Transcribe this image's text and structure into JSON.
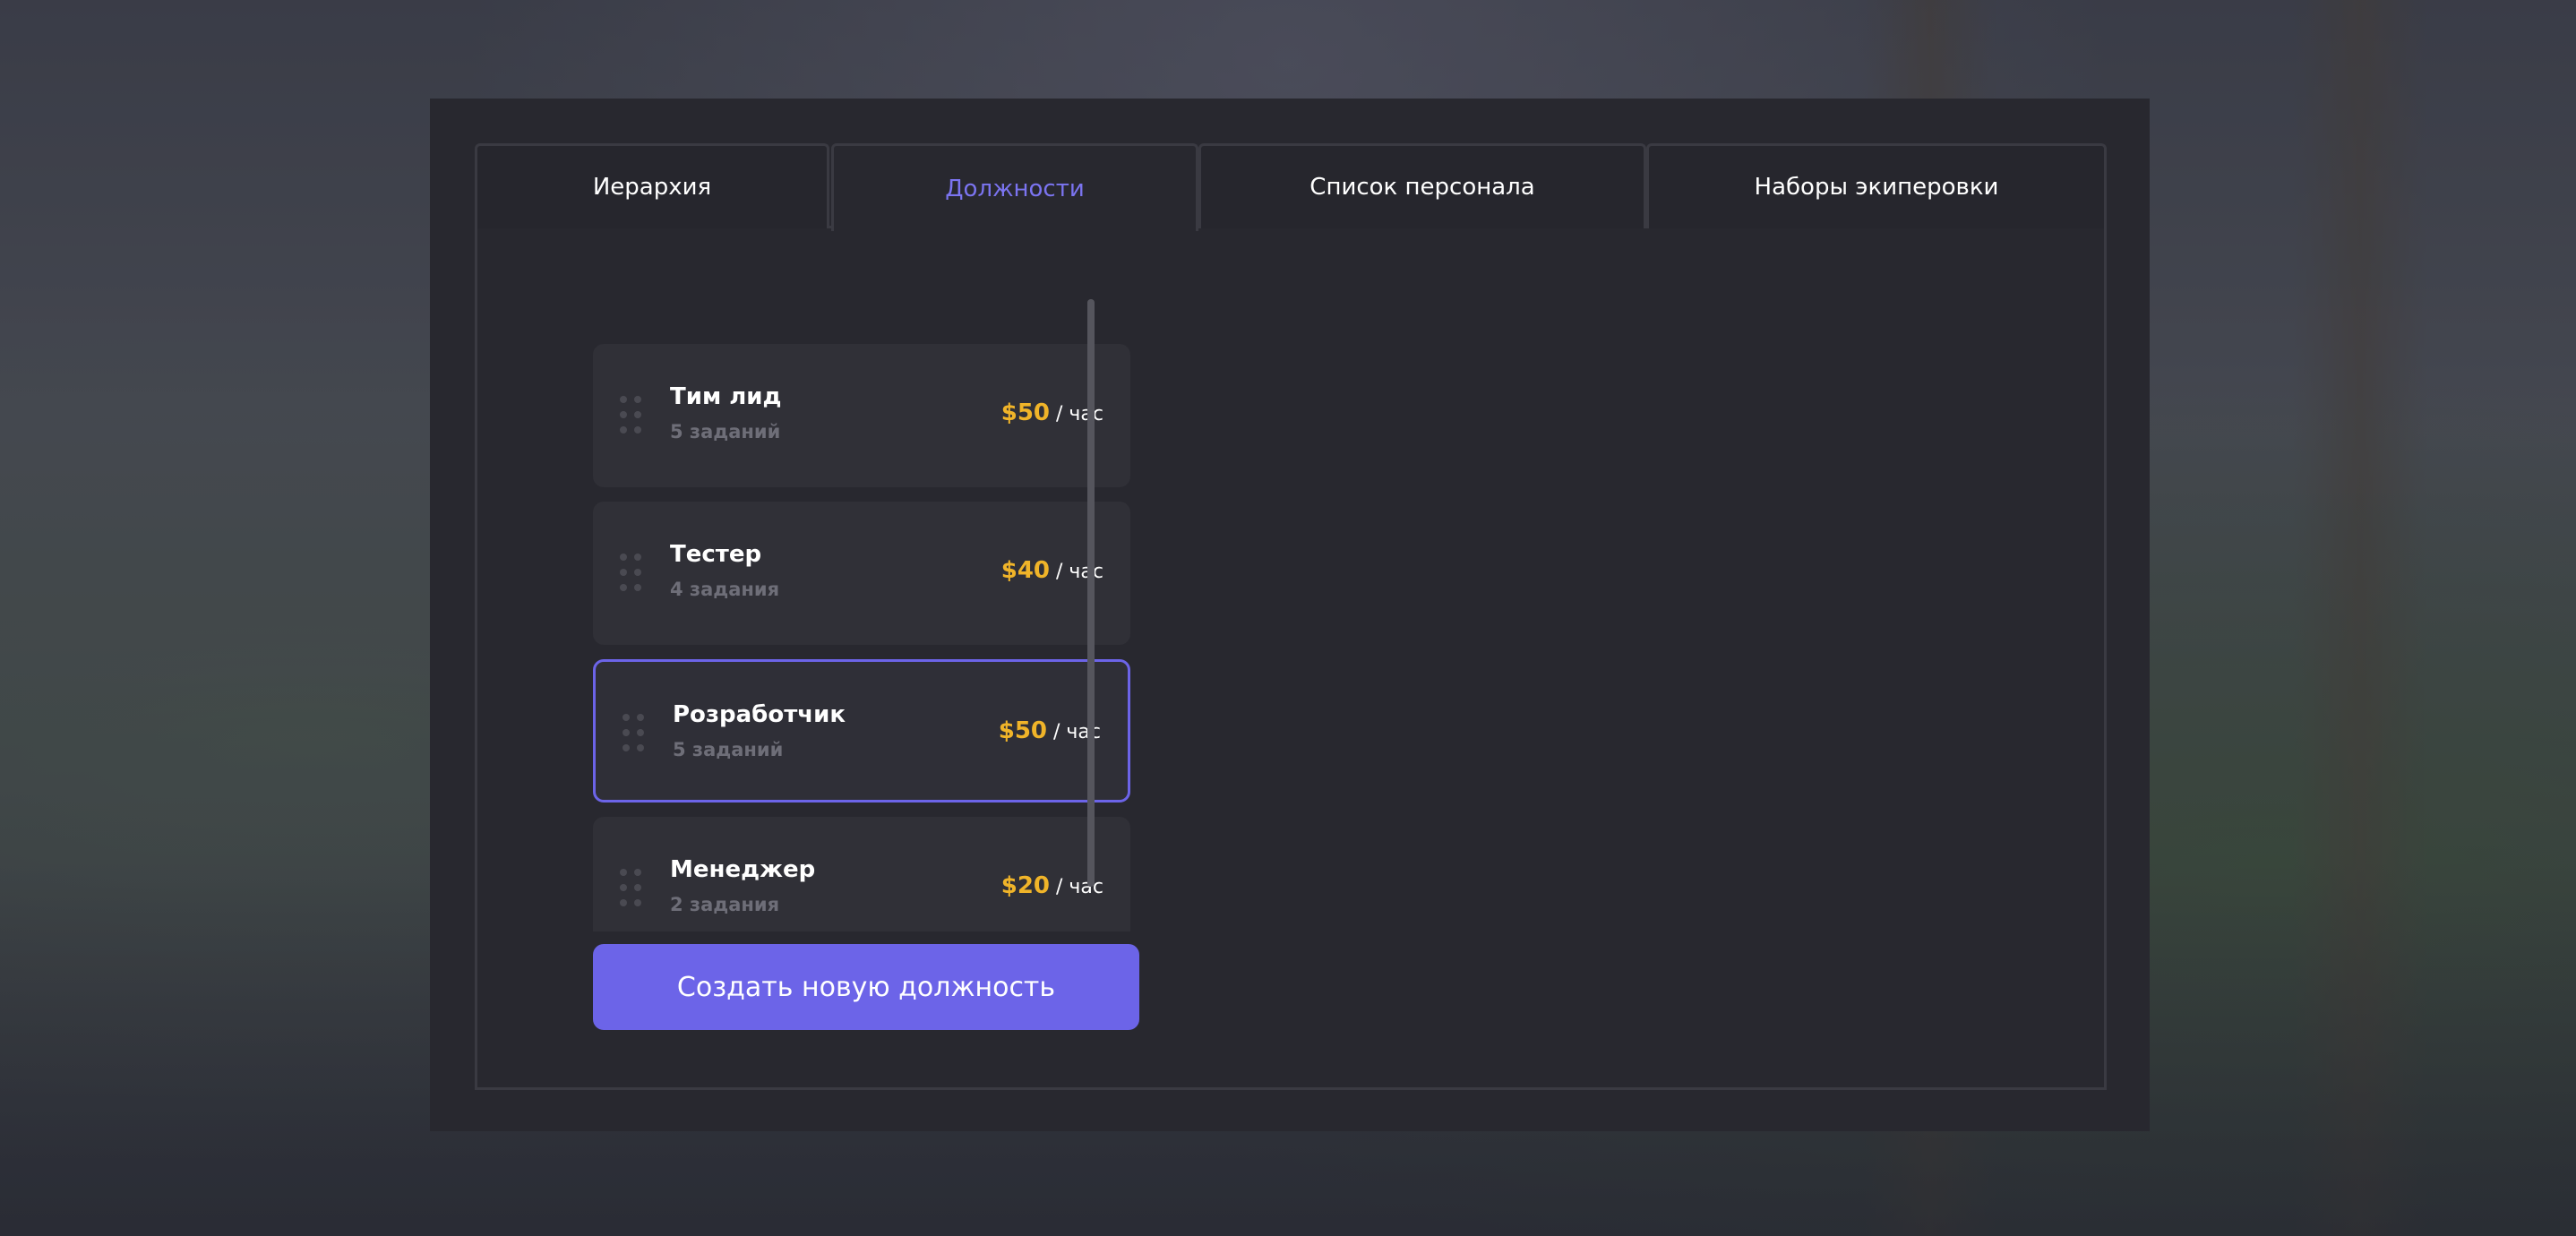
{
  "tabs": [
    {
      "label": "Иерархия",
      "active": false
    },
    {
      "label": "Должности",
      "active": true
    },
    {
      "label": "Список персонала",
      "active": false
    },
    {
      "label": "Наборы экиперовки",
      "active": false
    }
  ],
  "positions": [
    {
      "name": "Тим лид",
      "tasks": "5 заданий",
      "rate": "$50",
      "unit": "/ час",
      "selected": false
    },
    {
      "name": "Тестер",
      "tasks": "4 задания",
      "rate": "$40",
      "unit": "/ час",
      "selected": false
    },
    {
      "name": "Розработчик",
      "tasks": "5 заданий",
      "rate": "$50",
      "unit": "/ час",
      "selected": true
    },
    {
      "name": "Менеджер",
      "tasks": "2 задания",
      "rate": "$20",
      "unit": "/ час",
      "selected": false
    }
  ],
  "create_button": {
    "label": "Создать новую должность"
  },
  "colors": {
    "accent": "#6c64e8",
    "active_tab_text": "#7b74f0",
    "rate_amount": "#f0b429",
    "panel_bg": "#28282f",
    "card_bg": "#303037"
  },
  "icons": {
    "drag_handle": "grip-dots-icon"
  }
}
